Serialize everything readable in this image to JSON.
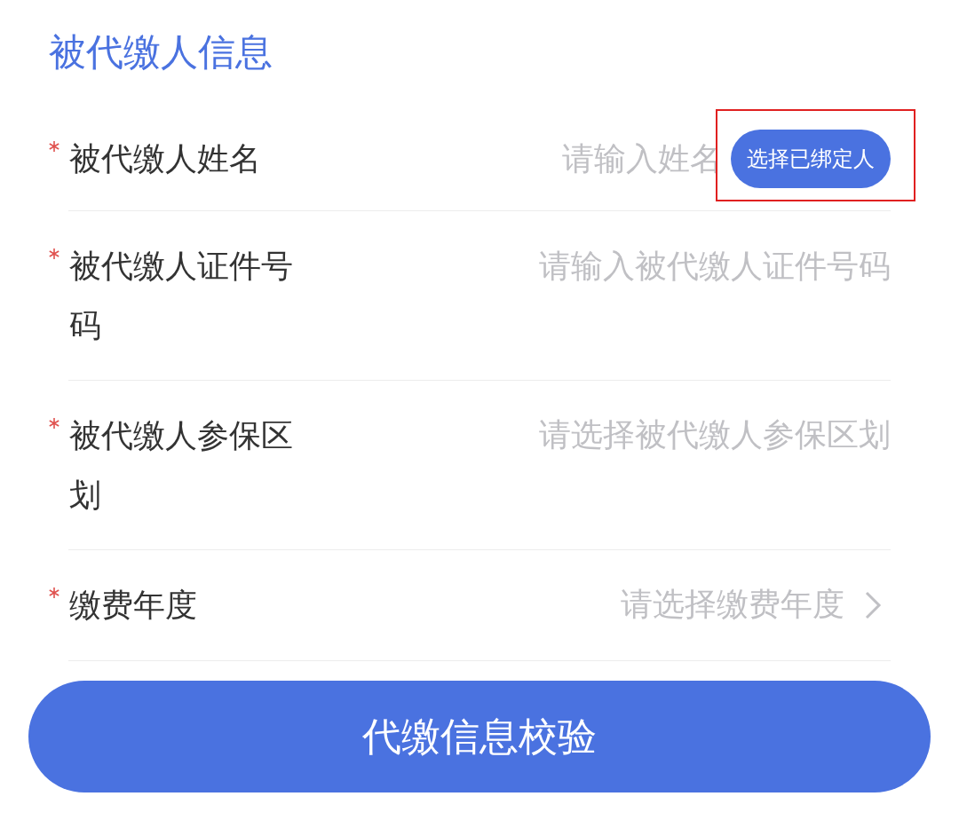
{
  "section_title": "被代缴人信息",
  "fields": [
    {
      "kind": "input",
      "required": true,
      "label": "被代缴人姓名",
      "placeholder": "请输入姓名",
      "button": {
        "label": "选择已绑定人",
        "highlighted": true
      }
    },
    {
      "kind": "input",
      "required": true,
      "label": "被代缴人证件号码",
      "placeholder": "请输入被代缴人证件号码"
    },
    {
      "kind": "select",
      "required": true,
      "label": "被代缴人参保区划",
      "placeholder": "请选择被代缴人参保区划"
    },
    {
      "kind": "select",
      "required": true,
      "label": "缴费年度",
      "placeholder": "请选择缴费年度",
      "chevron": true
    }
  ],
  "submit_button": "代缴信息校验"
}
